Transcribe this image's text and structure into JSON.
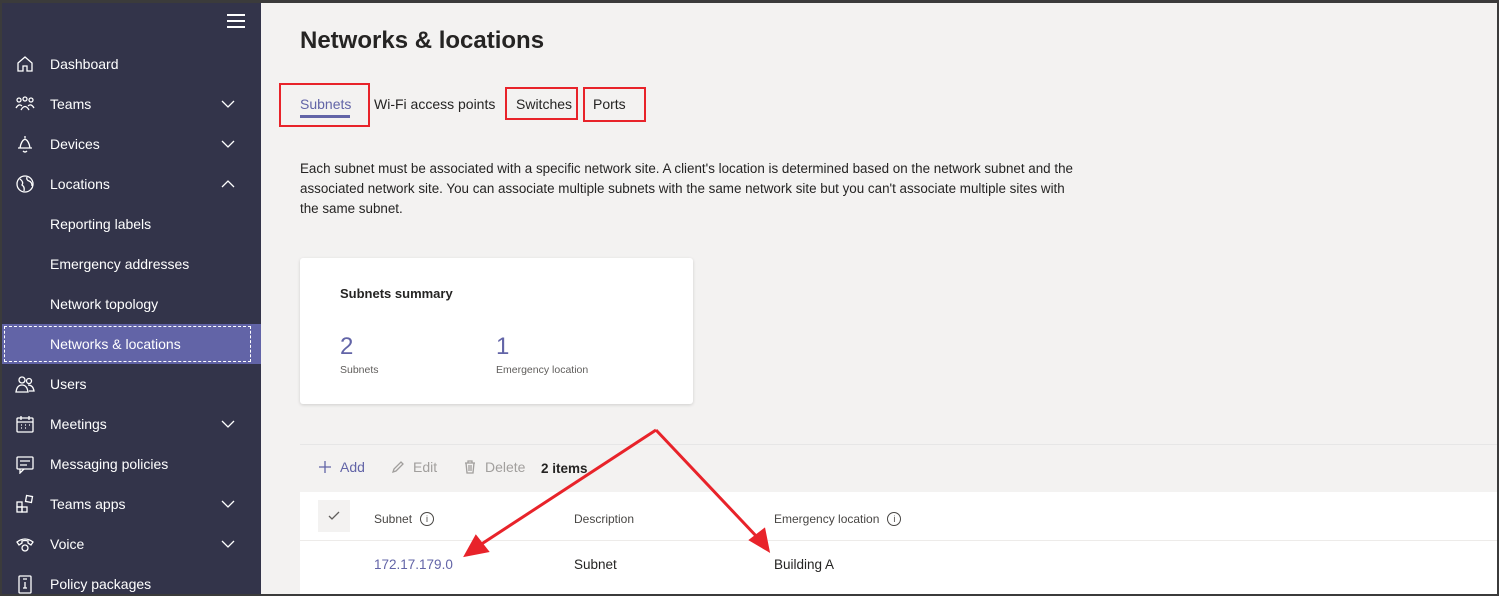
{
  "sidebar": {
    "menu_icon": "hamburger-icon",
    "items": [
      {
        "label": "Dashboard",
        "icon": "home-icon"
      },
      {
        "label": "Teams",
        "icon": "teams-icon"
      },
      {
        "label": "Devices",
        "icon": "bell-icon"
      },
      {
        "label": "Locations",
        "icon": "globe-icon"
      },
      {
        "label": "Reporting labels"
      },
      {
        "label": "Emergency addresses"
      },
      {
        "label": "Network topology"
      },
      {
        "label": "Networks & locations"
      },
      {
        "label": "Users",
        "icon": "users-icon"
      },
      {
        "label": "Meetings",
        "icon": "calendar-icon"
      },
      {
        "label": "Messaging policies",
        "icon": "message-icon"
      },
      {
        "label": "Teams apps",
        "icon": "apps-icon"
      },
      {
        "label": "Voice",
        "icon": "phone-icon"
      },
      {
        "label": "Policy packages",
        "icon": "package-icon"
      }
    ]
  },
  "page": {
    "title": "Networks & locations",
    "tabs": [
      {
        "label": "Subnets"
      },
      {
        "label": "Wi-Fi access points"
      },
      {
        "label": "Switches"
      },
      {
        "label": "Ports"
      }
    ],
    "description": "Each subnet must be associated with a specific network site. A client's location is determined based on the network subnet and the associated network site. You can associate multiple subnets with the same network site but you can't associate multiple sites with the same subnet."
  },
  "summary": {
    "title": "Subnets summary",
    "stats": [
      {
        "value": "2",
        "label": "Subnets"
      },
      {
        "value": "1",
        "label": "Emergency location"
      }
    ]
  },
  "toolbar": {
    "add_label": "Add",
    "edit_label": "Edit",
    "delete_label": "Delete",
    "count_label": "2 items"
  },
  "table": {
    "columns": [
      "Subnet",
      "Description",
      "Emergency location"
    ],
    "rows": [
      {
        "subnet": "172.17.179.0",
        "description": "Subnet",
        "emergency_location": "Building A"
      }
    ]
  },
  "annotation_color": "#e8232a",
  "accent_color": "#6264a7"
}
